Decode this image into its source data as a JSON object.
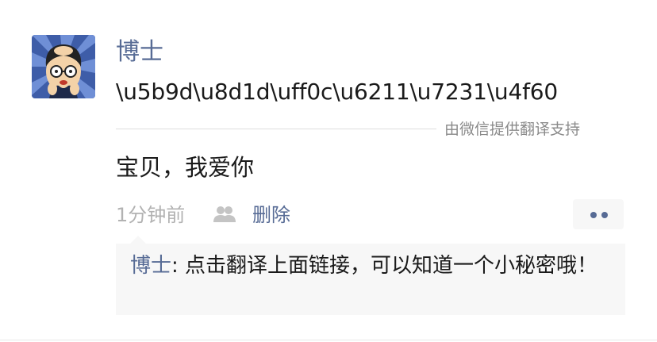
{
  "post": {
    "author": "博士",
    "text": "\\u5b9d\\u8d1d\\uff0c\\u6211\\u7231\\u4f60",
    "translate_provider": "由微信提供翻译支持",
    "translated_text": "宝贝，我爱你",
    "time_ago": "1分钟前",
    "delete_label": "删除",
    "visibility_icon": "friends-icon",
    "more_icon": "more-dots-icon"
  },
  "comments": [
    {
      "author": "博士",
      "separator": ": ",
      "text": "点击翻译上面链接，可以知道一个小秘密哦！"
    }
  ],
  "colors": {
    "link_blue": "#576b95",
    "text_dark": "#1a1a1a",
    "text_gray": "#b2b2b2",
    "comment_bg": "#f7f7f7"
  }
}
